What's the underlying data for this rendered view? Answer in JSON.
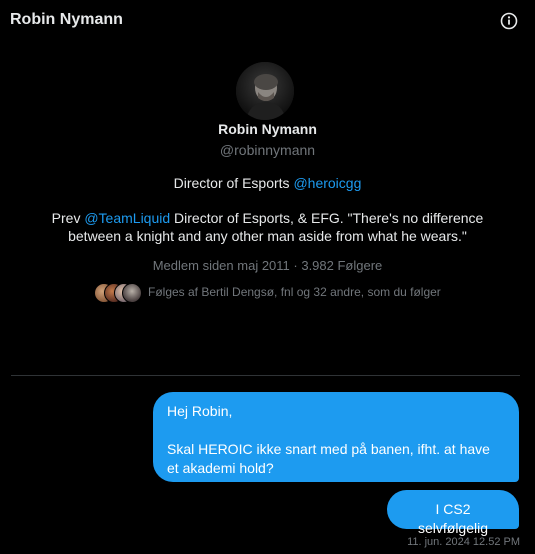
{
  "header": {
    "title": "Robin Nymann",
    "info_icon": "info-circle-icon"
  },
  "profile": {
    "name": "Robin Nymann",
    "handle": "@robinnymann",
    "bio_line1_prefix": "Director of Esports ",
    "bio_line1_mention": "@heroicgg",
    "bio_line2_prefix": "Prev ",
    "bio_line2_mention": "@TeamLiquid",
    "bio_line2_suffix": " Director of Esports, & EFG. \"There's no difference between a knight and any other man aside from what he wears.\"",
    "member_since": "Medlem siden maj 2011",
    "separator": " · ",
    "followers": "3.982 Følgere",
    "followed_by": "Følges af Bertil Dengsø, fnl og 32 andre, som du følger"
  },
  "messages": [
    {
      "line1": "Hej Robin,",
      "line2": "Skal HEROIC ikke snart med på banen, ifht. at have et akademi hold?"
    },
    {
      "text": "I CS2 selvfølgelig"
    }
  ],
  "timestamp": "11. jun. 2024 12.52 PM",
  "colors": {
    "background": "#000000",
    "text": "#e7e9ea",
    "muted": "#71767b",
    "accent": "#1d9bf0",
    "divider": "#2f3336"
  }
}
